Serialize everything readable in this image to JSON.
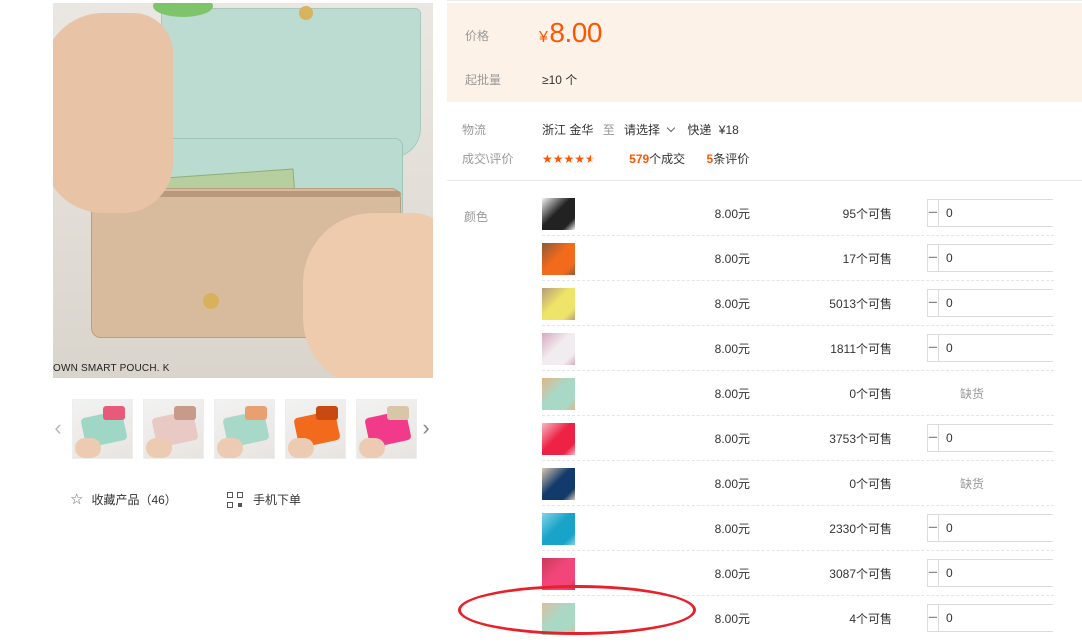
{
  "main_image": {
    "caption": "OWN SMART POUCH. K"
  },
  "thumbnails": [
    {
      "color": "#9fd7c6",
      "accent": "#e85a7a"
    },
    {
      "color": "#e9c9c3",
      "accent": "#c79a8a"
    },
    {
      "color": "#a8d8c7",
      "accent": "#e8a070"
    },
    {
      "color": "#f26a1b",
      "accent": "#c84a10"
    },
    {
      "color": "#f23a8a",
      "accent": "#d8c6a9"
    }
  ],
  "actions": {
    "favorite_label": "收藏产品（46）",
    "favorite_icon": "star-outline-icon",
    "mobile_label": "手机下单",
    "mobile_icon": "qr-code-icon"
  },
  "price": {
    "label": "价格",
    "currency": "¥",
    "value": "8.00",
    "moq_label": "起批量",
    "moq_value": "≥10 个",
    "accent_color": "#ff5500",
    "box_color": "#fdf2e8"
  },
  "shipping": {
    "label": "物流",
    "origin": "浙江 金华",
    "to": "至",
    "select": "请选择",
    "method": "快递",
    "fee": "¥18"
  },
  "deal": {
    "label": "成交\\评价",
    "rating": 4.5,
    "stars_text": "★★★★★",
    "deals_count": "579",
    "deals_suffix": "个成交",
    "reviews_count": "5",
    "reviews_suffix": "条评价"
  },
  "variants": {
    "label": "颜色",
    "rows": [
      {
        "price": "8.00元",
        "stock": "95个可售",
        "qty": "0",
        "soldout": false,
        "swatch": "#222222",
        "swatch2": "#f4f4f4"
      },
      {
        "price": "8.00元",
        "stock": "17个可售",
        "qty": "0",
        "soldout": false,
        "swatch": "#f26a1b",
        "swatch2": "#8a5a3a"
      },
      {
        "price": "8.00元",
        "stock": "5013个可售",
        "qty": "0",
        "soldout": false,
        "swatch": "#efe46a",
        "swatch2": "#b89a7a"
      },
      {
        "price": "8.00元",
        "stock": "1811个可售",
        "qty": "0",
        "soldout": false,
        "swatch": "#f1ecef",
        "swatch2": "#d9a8c0"
      },
      {
        "price": "8.00元",
        "stock": "0个可售",
        "qty": "",
        "soldout": true,
        "soldout_label": "缺货",
        "swatch": "#a8d9c6",
        "swatch2": "#e4b48a"
      },
      {
        "price": "8.00元",
        "stock": "3753个可售",
        "qty": "0",
        "soldout": false,
        "swatch": "#ee2244",
        "swatch2": "#f7b7c4"
      },
      {
        "price": "8.00元",
        "stock": "0个可售",
        "qty": "",
        "soldout": true,
        "soldout_label": "缺货",
        "swatch": "#123a6b",
        "swatch2": "#d8c8b0"
      },
      {
        "price": "8.00元",
        "stock": "2330个可售",
        "qty": "0",
        "soldout": false,
        "swatch": "#1aa3c8",
        "swatch2": "#7fd4e6"
      },
      {
        "price": "8.00元",
        "stock": "3087个可售",
        "qty": "0",
        "soldout": false,
        "swatch": "#f2467a",
        "swatch2": "#c93a5a"
      },
      {
        "price": "8.00元",
        "stock": "4个可售",
        "qty": "0",
        "soldout": false,
        "swatch": "#a9d8c5",
        "swatch2": "#d8bfa0"
      }
    ]
  },
  "annotation": {
    "color": "#e8202a"
  }
}
